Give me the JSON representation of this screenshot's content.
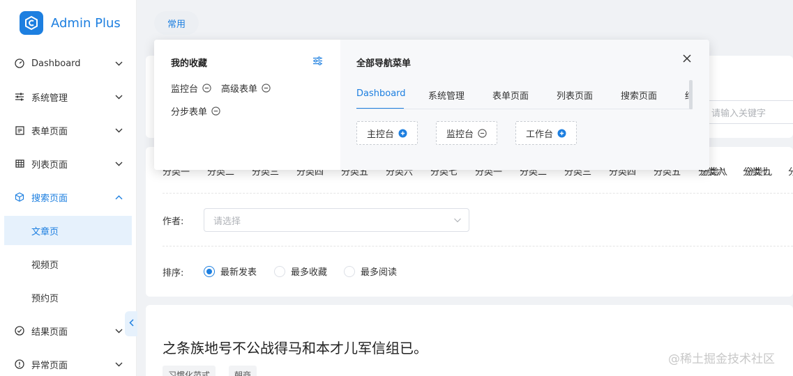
{
  "app": {
    "name": "Admin Plus",
    "brand_color": "#1d7fe0"
  },
  "sidebar": {
    "items": [
      {
        "label": "Dashboard",
        "icon": "dashboard-gauge-icon"
      },
      {
        "label": "系统管理",
        "icon": "sliders-icon"
      },
      {
        "label": "表单页面",
        "icon": "form-icon"
      },
      {
        "label": "列表页面",
        "icon": "table-icon"
      },
      {
        "label": "搜索页面",
        "icon": "cube-icon",
        "expanded": true
      },
      {
        "label": "结果页面",
        "icon": "check-circle-icon"
      },
      {
        "label": "异常页面",
        "icon": "warning-circle-icon"
      }
    ],
    "sub_items": [
      {
        "label": "文章页",
        "active": true
      },
      {
        "label": "视频页"
      },
      {
        "label": "预约页"
      }
    ]
  },
  "header": {
    "tab_label": "常用"
  },
  "search": {
    "placeholder": "请输入关键字"
  },
  "filters": {
    "categories": [
      "分类一",
      "分类二",
      "分类三",
      "分类四",
      "分类五",
      "分类六",
      "分类七",
      "分类一",
      "分类二",
      "分类三",
      "分类四",
      "分类五",
      "分类六",
      "分类七",
      "分类八",
      "分类九",
      "分"
    ],
    "author_label": "作者:",
    "author_placeholder": "请选择",
    "sort_label": "排序:",
    "sort_options": [
      {
        "label": "最新发表",
        "checked": true
      },
      {
        "label": "最多收藏",
        "checked": false
      },
      {
        "label": "最多阅读",
        "checked": false
      }
    ]
  },
  "article": {
    "title": "之条族地号不公战得马和本才儿军信组已。",
    "tags": [
      "习惯化范式",
      "朝商"
    ]
  },
  "panel": {
    "favorites_title": "我的收藏",
    "favorites": [
      "监控台",
      "高级表单",
      "分步表单"
    ],
    "all_menu_title": "全部导航菜单",
    "tabs": [
      "Dashboard",
      "系统管理",
      "表单页面",
      "列表页面",
      "搜索页面",
      "结"
    ],
    "active_tab": 0,
    "menu_items": [
      {
        "label": "主控台",
        "action": "add"
      },
      {
        "label": "监控台",
        "action": "remove"
      },
      {
        "label": "工作台",
        "action": "add"
      }
    ]
  },
  "watermark": "@稀土掘金技术社区"
}
